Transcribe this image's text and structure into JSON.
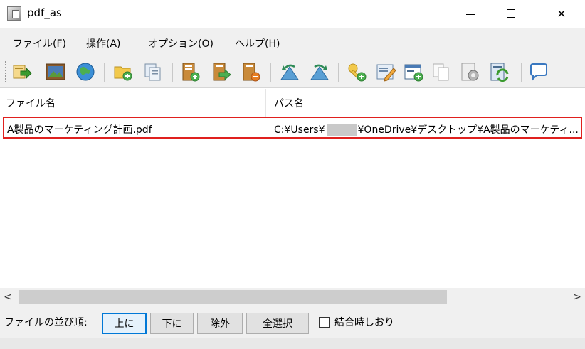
{
  "window": {
    "title": "pdf_as",
    "minimize_glyph": "—",
    "maximize_glyph": "☐",
    "close_glyph": "✕"
  },
  "menu": {
    "items": [
      {
        "label": "ファイル(F)"
      },
      {
        "label": "操作(A)"
      },
      {
        "label": "オプション(O)"
      },
      {
        "label": "ヘルプ(H)"
      }
    ]
  },
  "toolbar": {
    "icons": [
      "export-icon",
      "picture-icon",
      "globe-icon",
      "folder-add-icon",
      "copy-pages-icon",
      "page-add-icon",
      "page-move-icon",
      "page-remove-icon",
      "rotate-left-icon",
      "rotate-right-icon",
      "key-add-icon",
      "edit-icon",
      "window-add-icon",
      "duplicate-icon",
      "settings-doc-icon",
      "refresh-doc-icon",
      "speech-bubble-icon"
    ]
  },
  "list": {
    "columns": [
      "ファイル名",
      "パス名"
    ],
    "rows": [
      {
        "filename": "A製品のマーケティング計画.pdf",
        "path_prefix": "C:¥Users¥",
        "path_suffix": "¥OneDrive¥デスクトップ¥A製品のマーケティ..."
      }
    ]
  },
  "scrollbar": {
    "left_glyph": "<",
    "right_glyph": ">"
  },
  "bottom": {
    "order_label": "ファイルの並び順:",
    "up_button": "上に",
    "down_button": "下に",
    "exclude_button": "除外",
    "select_all_button": "全選択",
    "bookmark_checkbox_label": "結合時しおり",
    "bookmark_checked": false
  },
  "colors": {
    "selection_outline": "#e0201e",
    "focused_button_border": "#0078d7",
    "chrome_background": "#f0f0f0"
  }
}
